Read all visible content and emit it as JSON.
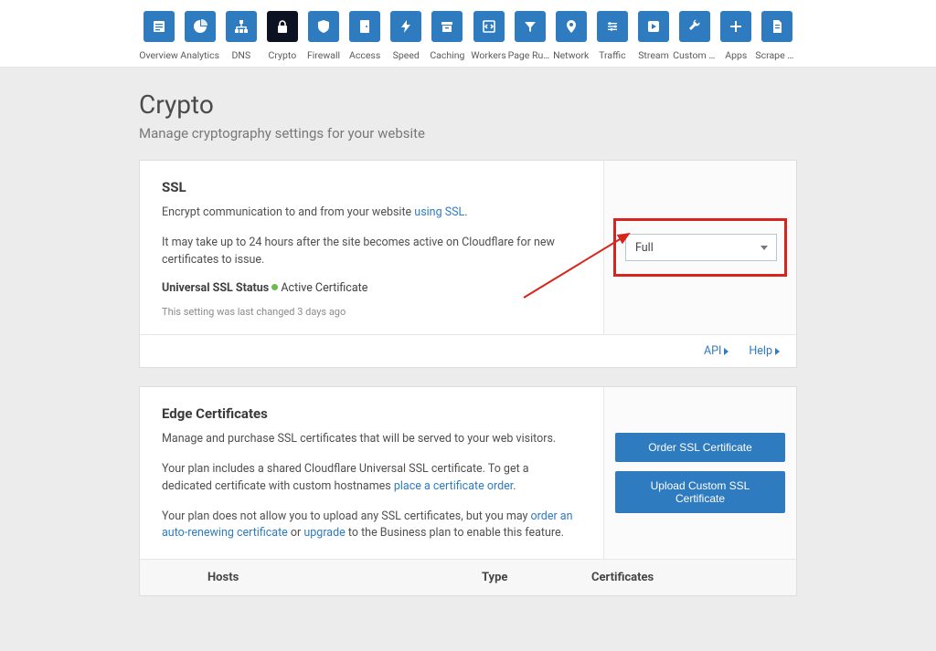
{
  "nav": {
    "items": [
      {
        "label": "Overview"
      },
      {
        "label": "Analytics"
      },
      {
        "label": "DNS"
      },
      {
        "label": "Crypto"
      },
      {
        "label": "Firewall"
      },
      {
        "label": "Access"
      },
      {
        "label": "Speed"
      },
      {
        "label": "Caching"
      },
      {
        "label": "Workers"
      },
      {
        "label": "Page Rules"
      },
      {
        "label": "Network"
      },
      {
        "label": "Traffic"
      },
      {
        "label": "Stream"
      },
      {
        "label": "Custom P…"
      },
      {
        "label": "Apps"
      },
      {
        "label": "Scrape Sh…"
      }
    ]
  },
  "page": {
    "title": "Crypto",
    "subtitle": "Manage cryptography settings for your website"
  },
  "ssl": {
    "title": "SSL",
    "desc_pre": "Encrypt communication to and from your website ",
    "desc_link": "using SSL",
    "desc_post": ".",
    "note": "It may take up to 24 hours after the site becomes active on Cloudflare for new certificates to issue.",
    "status_label": "Universal SSL Status",
    "status_text": "Active Certificate",
    "meta": "This setting was last changed 3 days ago",
    "select_value": "Full",
    "footer_api": "API",
    "footer_help": "Help"
  },
  "edge": {
    "title": "Edge Certificates",
    "p1": "Manage and purchase SSL certificates that will be served to your web visitors.",
    "p2_pre": "Your plan includes a shared Cloudflare Universal SSL certificate. To get a dedicated certificate with custom hostnames ",
    "p2_link": "place a certificate order",
    "p2_post": ".",
    "p3_pre": "Your plan does not allow you to upload any SSL certificates, but you may ",
    "p3_link1": "order an auto-renewing certificate",
    "p3_mid": " or ",
    "p3_link2": "upgrade",
    "p3_post": " to the Business plan to enable this feature.",
    "btn_order": "Order SSL Certificate",
    "btn_upload": "Upload Custom SSL Certificate",
    "th_hosts": "Hosts",
    "th_type": "Type",
    "th_certs": "Certificates"
  }
}
